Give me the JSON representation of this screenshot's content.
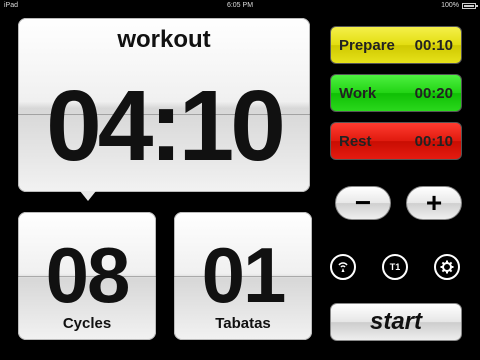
{
  "status": {
    "carrier": "iPad",
    "time": "6:05 PM",
    "battery": "100%"
  },
  "main": {
    "title": "workout",
    "time": "04:10"
  },
  "cycles": {
    "value": "08",
    "label": "Cycles"
  },
  "tabatas": {
    "value": "01",
    "label": "Tabatas"
  },
  "intervals": [
    {
      "label": "Prepare",
      "time": "00:10",
      "color": "#e5df10"
    },
    {
      "label": "Work",
      "time": "00:20",
      "color": "#1fd412"
    },
    {
      "label": "Rest",
      "time": "00:10",
      "color": "#e0180c"
    }
  ],
  "controls": {
    "minus": "−",
    "plus": "+",
    "start": "start",
    "t1_label": "T1",
    "icons": [
      "signal-icon",
      "t1-icon",
      "gear-icon"
    ]
  }
}
